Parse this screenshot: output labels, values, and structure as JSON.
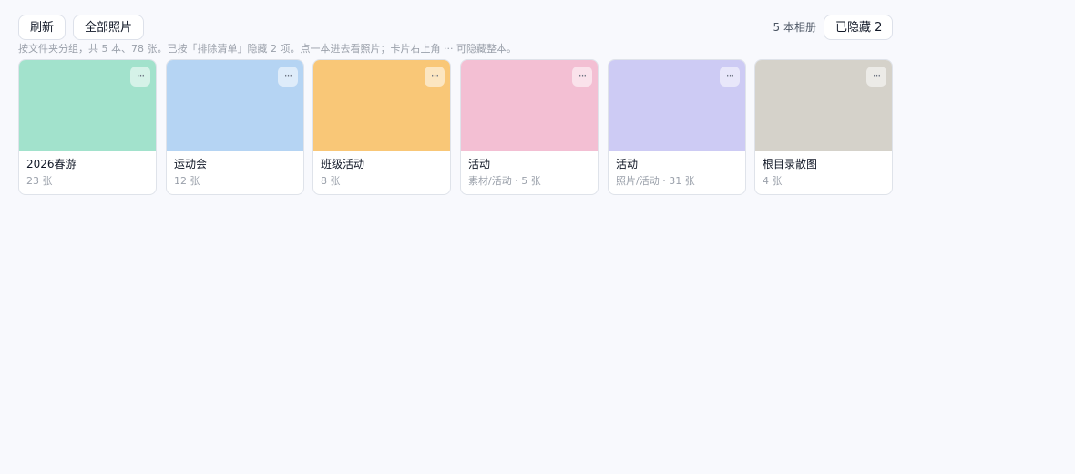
{
  "toolbar": {
    "refresh_label": "刷新",
    "all_photos_label": "全部照片",
    "album_count": "5 本相册",
    "hidden_label": "已隐藏 2"
  },
  "hint": "按文件夹分组，共 5 本、78 张。已按「排除清单」隐藏 2 项。点一本进去看照片；卡片右上角 ··· 可隐藏整本。",
  "albums": [
    {
      "title": "2026春游",
      "subtitle": "23 张",
      "color": "#a2e2cc",
      "more": "···"
    },
    {
      "title": "运动会",
      "subtitle": "12 张",
      "color": "#b5d4f3",
      "more": "···"
    },
    {
      "title": "班级活动",
      "subtitle": "8 张",
      "color": "#f9c777",
      "more": "···"
    },
    {
      "title": "活动",
      "subtitle": "素材/活动 · 5 张",
      "color": "#f3bfd3",
      "more": "···"
    },
    {
      "title": "活动",
      "subtitle": "照片/活动 · 31 张",
      "color": "#cdcbf4",
      "more": "···"
    },
    {
      "title": "根目录散图",
      "subtitle": "4 张",
      "color": "#d5d2ca",
      "more": "···"
    }
  ]
}
